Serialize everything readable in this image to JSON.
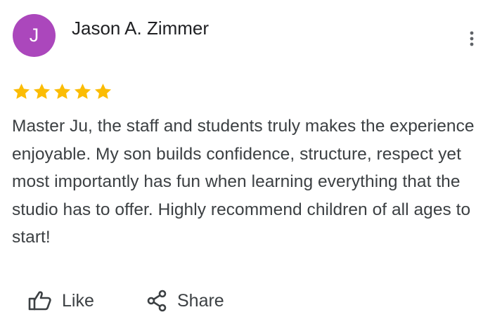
{
  "reviewer": {
    "avatar_letter": "J",
    "avatar_color": "#ab47bc",
    "name": "Jason A. Zimmer"
  },
  "menu": {
    "icon": "more-vertical-icon"
  },
  "rating": {
    "stars": 5,
    "max": 5,
    "star_color": "#fbbc04",
    "icon": "star-icon"
  },
  "review": {
    "text": "Master Ju, the staff and students truly makes the experience enjoyable. My son builds confidence, structure, respect yet most importantly has fun when learning everything that the studio has to offer. Highly recommend children of all ages to start!"
  },
  "actions": {
    "like_label": "Like",
    "like_icon": "thumbs-up-icon",
    "share_label": "Share",
    "share_icon": "share-icon"
  }
}
